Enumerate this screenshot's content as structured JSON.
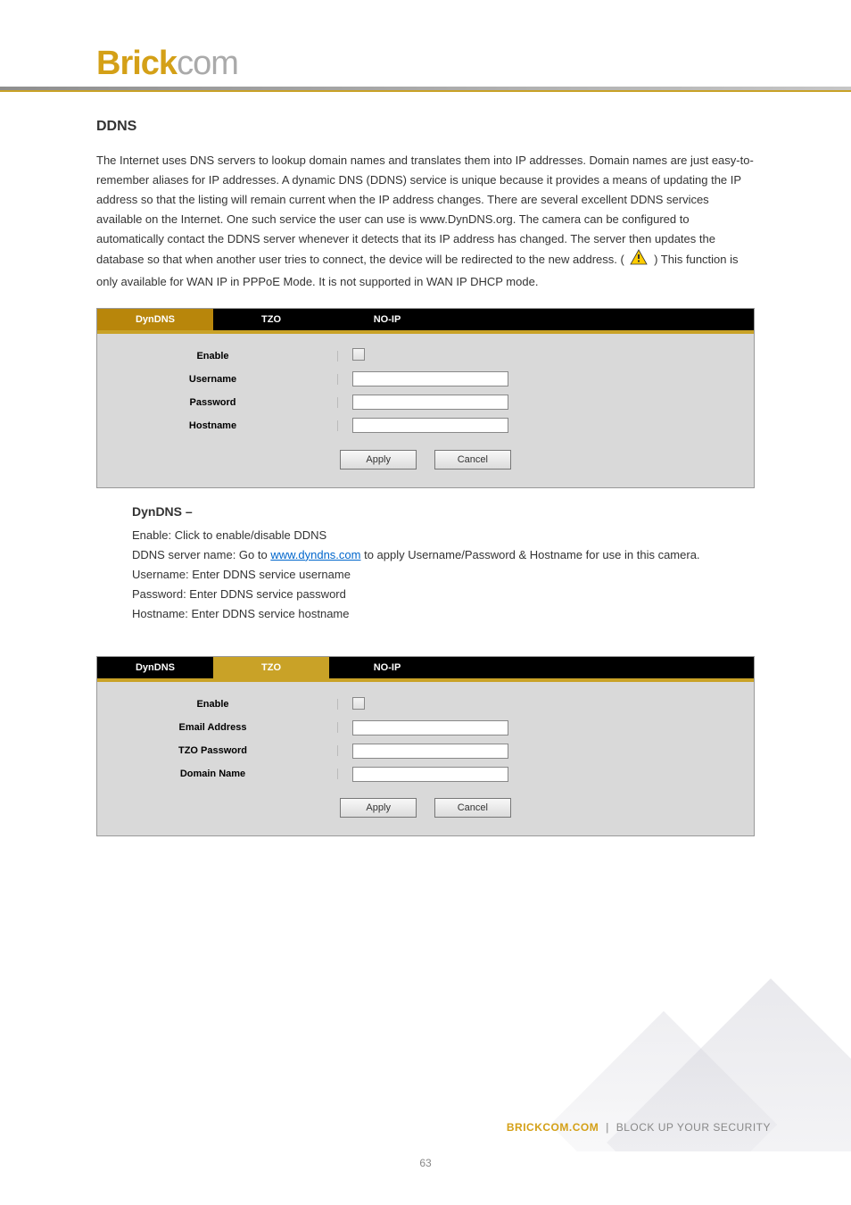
{
  "logo": {
    "part1": "Brick",
    "part2": "com"
  },
  "section": {
    "title": "DDNS",
    "intro_1": "The Internet uses DNS servers to lookup domain names and translates them into IP addresses. Domain names are just easy-to-remember aliases for IP addresses. A dynamic DNS (DDNS) service is unique because it provides a means of updating the IP address so that the listing will remain current when the IP address changes. There are several excellent DDNS services available on the Internet. One such service the user can use is www.DynDNS.org. The camera can be configured to automatically contact the DDNS server whenever it detects that its IP address has changed. The server then updates the database so that when another user tries to connect, the device will be redirected to the new address. (",
    "intro_2": ") This function is only available for WAN IP in PPPoE Mode. It is not supported in WAN IP DHCP mode.",
    "dyndns_title": "DynDNS –",
    "dyndns_1": "Enable: Click to enable/disable DDNS",
    "dyndns_link_pre": "DDNS server name: Go to ",
    "dyndns_link": "www.dyndns.com",
    "dyndns_link_post": " to apply Username/Password & Hostname for use in this camera.",
    "dyndns_3": "Username: Enter DDNS service username",
    "dyndns_4": "Password: Enter DDNS service password",
    "dyndns_5": "Hostname: Enter DDNS service hostname"
  },
  "panel1": {
    "tabs": [
      "DynDNS",
      "TZO",
      "NO-IP"
    ],
    "rows": {
      "enable": "Enable",
      "username": "Username",
      "password": "Password",
      "hostname": "Hostname"
    },
    "apply": "Apply",
    "cancel": "Cancel"
  },
  "panel2": {
    "tabs": [
      "DynDNS",
      "TZO",
      "NO-IP"
    ],
    "rows": {
      "enable": "Enable",
      "email": "Email Address",
      "tzopw": "TZO Password",
      "domain": "Domain Name"
    },
    "apply": "Apply",
    "cancel": "Cancel"
  },
  "footer": {
    "brand": "BRICKCOM.COM",
    "sep": "|",
    "tag": "BLOCK UP YOUR SECURITY",
    "page": "63"
  }
}
